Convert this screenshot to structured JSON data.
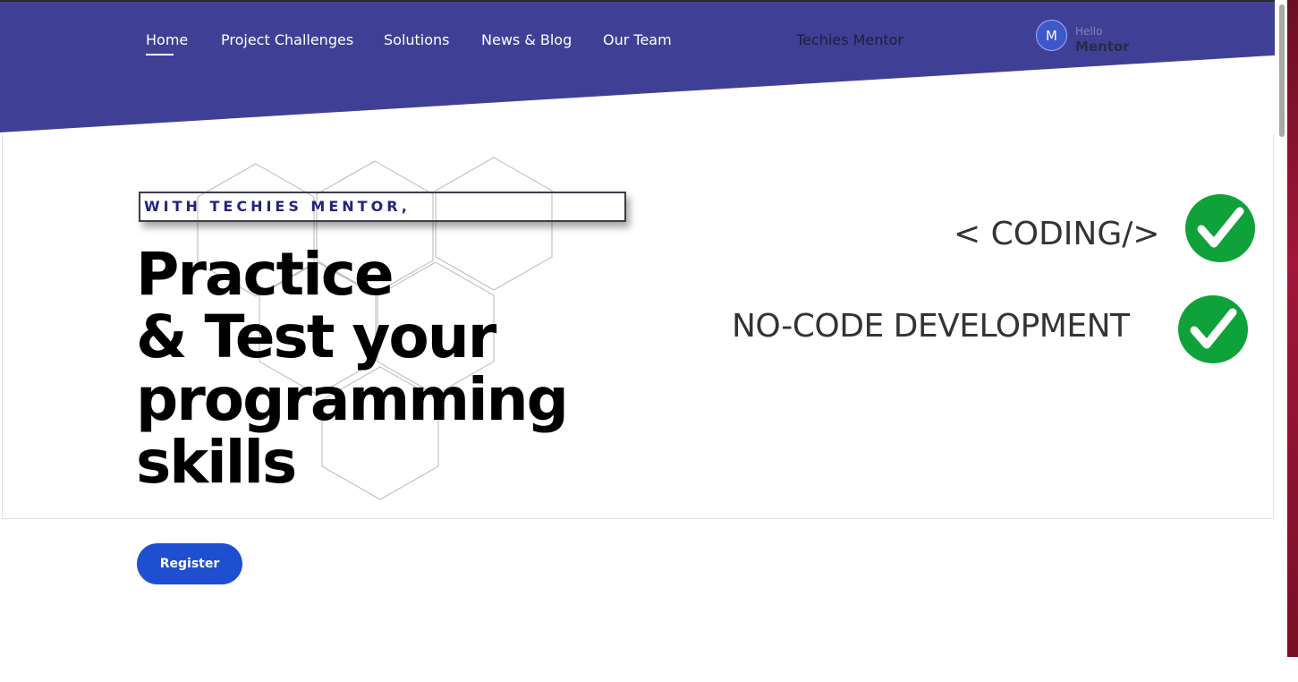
{
  "nav": {
    "items": [
      {
        "label": "Home",
        "active": true
      },
      {
        "label": "Project Challenges",
        "active": false
      },
      {
        "label": "Solutions",
        "active": false
      },
      {
        "label": "News & Blog",
        "active": false
      },
      {
        "label": "Our Team",
        "active": false
      }
    ],
    "brand": "Techies Mentor"
  },
  "user": {
    "initial": "M",
    "greeting": "Hello",
    "name": "Mentor"
  },
  "hero": {
    "tagline": "WITH TECHIES MENTOR,",
    "headline": [
      "Practice",
      "& Test your",
      "programming",
      "skills"
    ],
    "register_label": "Register"
  },
  "features": {
    "coding": "< CODING/>",
    "nocode": "NO-CODE DEVELOPMENT"
  },
  "colors": {
    "header": "#3f4095",
    "button": "#1f4fd1",
    "check": "#0fa23a",
    "tagline_text": "#23237a"
  },
  "icons": {
    "check": "check-circle-icon",
    "avatar": "user-avatar"
  }
}
